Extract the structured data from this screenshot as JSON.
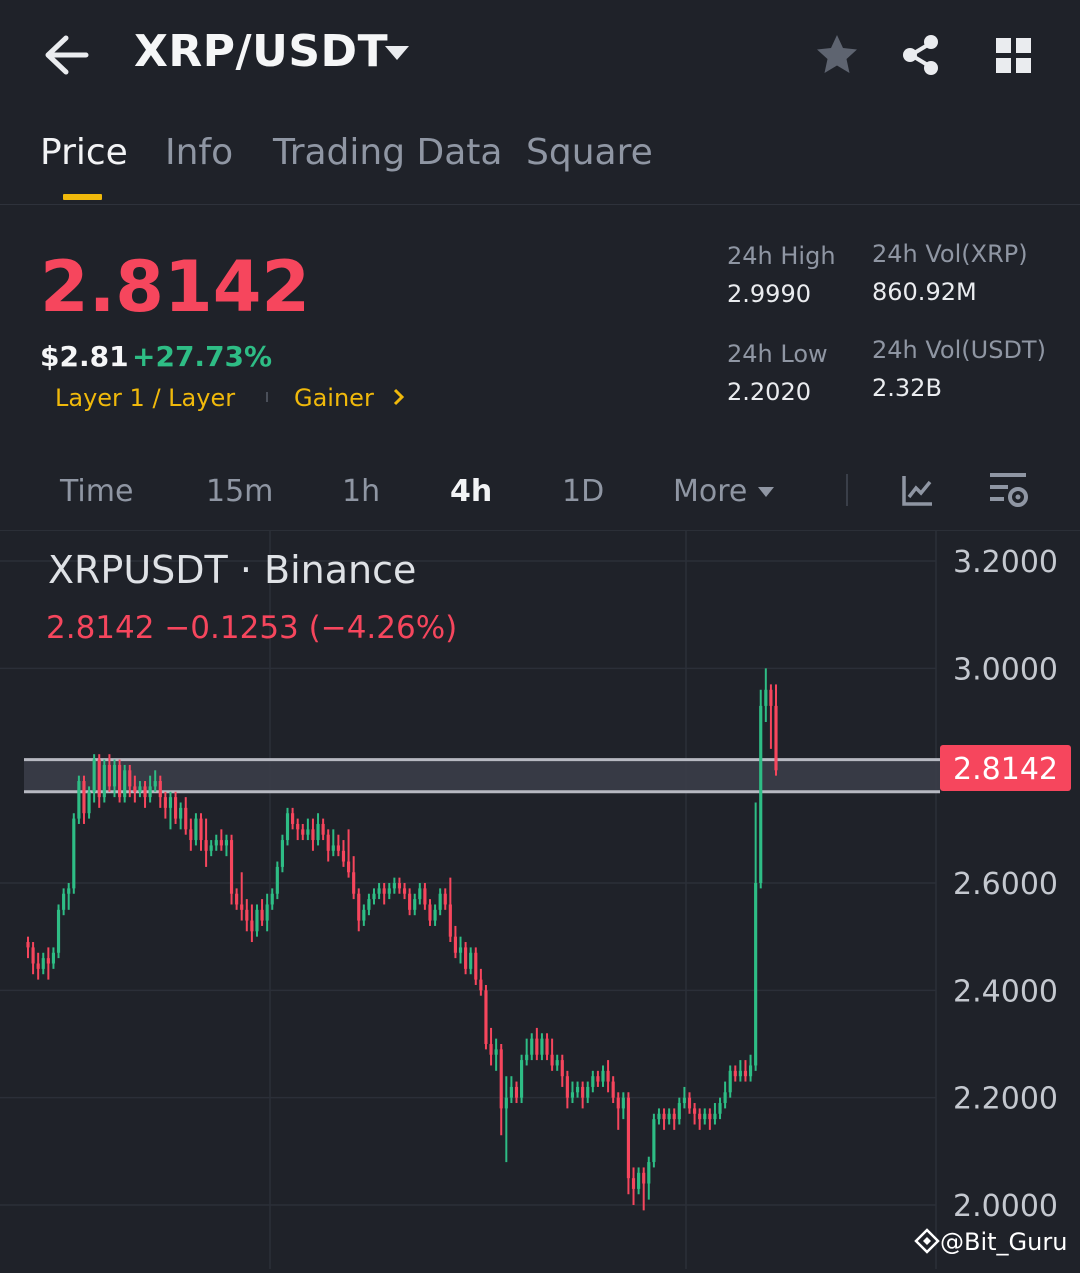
{
  "header": {
    "back_icon": "arrow-left-icon",
    "pair": "XRP/USDT",
    "dropdown_icon": "caret-down-icon",
    "favorite_icon": "star-icon",
    "share_icon": "share-icon",
    "grid_icon": "grid-icon"
  },
  "tabs": [
    {
      "label": "Price",
      "active": true
    },
    {
      "label": "Info",
      "active": false
    },
    {
      "label": "Trading Data",
      "active": false
    },
    {
      "label": "Square",
      "active": false
    }
  ],
  "ticker": {
    "last_price": "2.8142",
    "usd_price": "$2.81",
    "change_pct": "+27.73%",
    "tag_category": "Layer 1 / Layer",
    "tag_gainer": "Gainer",
    "stats": {
      "high_label": "24h High",
      "high_value": "2.9990",
      "low_label": "24h Low",
      "low_value": "2.2020",
      "vol_base_label": "24h Vol(XRP)",
      "vol_base_value": "860.92M",
      "vol_quote_label": "24h Vol(USDT)",
      "vol_quote_value": "2.32B"
    }
  },
  "intervals": {
    "items": [
      "Time",
      "15m",
      "1h",
      "4h",
      "1D",
      "More"
    ],
    "active": "4h"
  },
  "chart_header": {
    "title": "XRPUSDT · Binance",
    "ohlc": "2.8142  −0.1253 (−4.26%)"
  },
  "watermark": "@Bit_Guru",
  "colors": {
    "background": "#1f2229",
    "up": "#2ebd85",
    "down": "#f6465d",
    "accent": "#f0b90b"
  },
  "chart_data": {
    "type": "candlestick",
    "symbol": "XRPUSDT",
    "exchange": "Binance",
    "interval": "4h",
    "ylim": [
      1.96,
      3.24
    ],
    "y_ticks": [
      "3.2000",
      "3.0000",
      "2.6000",
      "2.4000",
      "2.2000",
      "2.0000"
    ],
    "last_price_label": "2.8142",
    "grid": true,
    "zone": [
      2.77,
      2.83
    ],
    "candles": [
      [
        2.49,
        2.48,
        2.5,
        2.46
      ],
      [
        2.48,
        2.45,
        2.49,
        2.43
      ],
      [
        2.45,
        2.44,
        2.47,
        2.42
      ],
      [
        2.44,
        2.46,
        2.47,
        2.43
      ],
      [
        2.46,
        2.45,
        2.48,
        2.42
      ],
      [
        2.45,
        2.47,
        2.48,
        2.44
      ],
      [
        2.47,
        2.55,
        2.56,
        2.46
      ],
      [
        2.55,
        2.58,
        2.59,
        2.54
      ],
      [
        2.58,
        2.59,
        2.6,
        2.55
      ],
      [
        2.59,
        2.72,
        2.73,
        2.58
      ],
      [
        2.72,
        2.79,
        2.8,
        2.71
      ],
      [
        2.79,
        2.73,
        2.8,
        2.71
      ],
      [
        2.73,
        2.77,
        2.78,
        2.72
      ],
      [
        2.77,
        2.83,
        2.84,
        2.75
      ],
      [
        2.83,
        2.76,
        2.84,
        2.74
      ],
      [
        2.76,
        2.82,
        2.83,
        2.75
      ],
      [
        2.82,
        2.78,
        2.84,
        2.77
      ],
      [
        2.78,
        2.82,
        2.83,
        2.76
      ],
      [
        2.82,
        2.76,
        2.83,
        2.75
      ],
      [
        2.76,
        2.81,
        2.82,
        2.75
      ],
      [
        2.81,
        2.78,
        2.82,
        2.76
      ],
      [
        2.78,
        2.77,
        2.8,
        2.75
      ],
      [
        2.77,
        2.78,
        2.79,
        2.76
      ],
      [
        2.78,
        2.76,
        2.79,
        2.74
      ],
      [
        2.76,
        2.78,
        2.8,
        2.75
      ],
      [
        2.78,
        2.79,
        2.81,
        2.77
      ],
      [
        2.79,
        2.76,
        2.8,
        2.74
      ],
      [
        2.76,
        2.74,
        2.77,
        2.72
      ],
      [
        2.74,
        2.76,
        2.77,
        2.7
      ],
      [
        2.76,
        2.72,
        2.77,
        2.71
      ],
      [
        2.72,
        2.74,
        2.75,
        2.7
      ],
      [
        2.74,
        2.7,
        2.76,
        2.69
      ],
      [
        2.7,
        2.68,
        2.72,
        2.66
      ],
      [
        2.68,
        2.72,
        2.73,
        2.67
      ],
      [
        2.72,
        2.68,
        2.73,
        2.66
      ],
      [
        2.68,
        2.66,
        2.72,
        2.63
      ],
      [
        2.66,
        2.67,
        2.68,
        2.65
      ],
      [
        2.67,
        2.68,
        2.69,
        2.66
      ],
      [
        2.68,
        2.67,
        2.7,
        2.66
      ],
      [
        2.67,
        2.68,
        2.69,
        2.65
      ],
      [
        2.68,
        2.58,
        2.69,
        2.56
      ],
      [
        2.58,
        2.56,
        2.59,
        2.55
      ],
      [
        2.56,
        2.55,
        2.62,
        2.53
      ],
      [
        2.55,
        2.53,
        2.57,
        2.51
      ],
      [
        2.53,
        2.51,
        2.56,
        2.49
      ],
      [
        2.51,
        2.55,
        2.56,
        2.5
      ],
      [
        2.55,
        2.53,
        2.57,
        2.52
      ],
      [
        2.53,
        2.56,
        2.58,
        2.51
      ],
      [
        2.56,
        2.58,
        2.59,
        2.55
      ],
      [
        2.58,
        2.63,
        2.64,
        2.57
      ],
      [
        2.63,
        2.68,
        2.69,
        2.62
      ],
      [
        2.68,
        2.73,
        2.74,
        2.67
      ],
      [
        2.73,
        2.71,
        2.74,
        2.7
      ],
      [
        2.71,
        2.7,
        2.72,
        2.68
      ],
      [
        2.7,
        2.69,
        2.71,
        2.68
      ],
      [
        2.69,
        2.7,
        2.72,
        2.68
      ],
      [
        2.7,
        2.68,
        2.72,
        2.66
      ],
      [
        2.68,
        2.71,
        2.73,
        2.67
      ],
      [
        2.71,
        2.69,
        2.72,
        2.68
      ],
      [
        2.69,
        2.66,
        2.7,
        2.64
      ],
      [
        2.66,
        2.67,
        2.7,
        2.65
      ],
      [
        2.67,
        2.66,
        2.69,
        2.65
      ],
      [
        2.66,
        2.64,
        2.68,
        2.63
      ],
      [
        2.64,
        2.62,
        2.7,
        2.61
      ],
      [
        2.62,
        2.58,
        2.65,
        2.57
      ],
      [
        2.58,
        2.53,
        2.59,
        2.51
      ],
      [
        2.53,
        2.55,
        2.56,
        2.52
      ],
      [
        2.55,
        2.57,
        2.58,
        2.54
      ],
      [
        2.57,
        2.58,
        2.59,
        2.56
      ],
      [
        2.58,
        2.59,
        2.6,
        2.57
      ],
      [
        2.59,
        2.58,
        2.6,
        2.56
      ],
      [
        2.58,
        2.59,
        2.6,
        2.57
      ],
      [
        2.59,
        2.6,
        2.61,
        2.58
      ],
      [
        2.6,
        2.59,
        2.61,
        2.58
      ],
      [
        2.59,
        2.58,
        2.6,
        2.57
      ],
      [
        2.58,
        2.55,
        2.59,
        2.54
      ],
      [
        2.55,
        2.57,
        2.58,
        2.54
      ],
      [
        2.57,
        2.59,
        2.6,
        2.56
      ],
      [
        2.59,
        2.56,
        2.6,
        2.55
      ],
      [
        2.56,
        2.53,
        2.57,
        2.52
      ],
      [
        2.53,
        2.55,
        2.56,
        2.52
      ],
      [
        2.55,
        2.58,
        2.59,
        2.54
      ],
      [
        2.58,
        2.56,
        2.59,
        2.55
      ],
      [
        2.56,
        2.5,
        2.61,
        2.49
      ],
      [
        2.5,
        2.47,
        2.52,
        2.46
      ],
      [
        2.47,
        2.48,
        2.5,
        2.45
      ],
      [
        2.48,
        2.44,
        2.49,
        2.43
      ],
      [
        2.44,
        2.47,
        2.48,
        2.43
      ],
      [
        2.47,
        2.42,
        2.48,
        2.41
      ],
      [
        2.42,
        2.4,
        2.44,
        2.39
      ],
      [
        2.4,
        2.3,
        2.41,
        2.29
      ],
      [
        2.3,
        2.28,
        2.33,
        2.26
      ],
      [
        2.28,
        2.29,
        2.31,
        2.25
      ],
      [
        2.29,
        2.18,
        2.3,
        2.13
      ],
      [
        2.18,
        2.2,
        2.24,
        2.08
      ],
      [
        2.2,
        2.22,
        2.24,
        2.19
      ],
      [
        2.22,
        2.2,
        2.23,
        2.19
      ],
      [
        2.2,
        2.27,
        2.28,
        2.19
      ],
      [
        2.27,
        2.28,
        2.31,
        2.26
      ],
      [
        2.28,
        2.31,
        2.32,
        2.27
      ],
      [
        2.31,
        2.28,
        2.33,
        2.27
      ],
      [
        2.28,
        2.31,
        2.32,
        2.27
      ],
      [
        2.31,
        2.28,
        2.32,
        2.27
      ],
      [
        2.28,
        2.26,
        2.31,
        2.25
      ],
      [
        2.26,
        2.27,
        2.28,
        2.25
      ],
      [
        2.27,
        2.24,
        2.28,
        2.22
      ],
      [
        2.24,
        2.2,
        2.25,
        2.18
      ],
      [
        2.2,
        2.21,
        2.23,
        2.19
      ],
      [
        2.21,
        2.22,
        2.23,
        2.2
      ],
      [
        2.22,
        2.2,
        2.23,
        2.18
      ],
      [
        2.2,
        2.22,
        2.23,
        2.19
      ],
      [
        2.22,
        2.24,
        2.25,
        2.21
      ],
      [
        2.24,
        2.23,
        2.25,
        2.22
      ],
      [
        2.23,
        2.25,
        2.26,
        2.22
      ],
      [
        2.25,
        2.23,
        2.27,
        2.21
      ],
      [
        2.23,
        2.2,
        2.24,
        2.19
      ],
      [
        2.2,
        2.18,
        2.21,
        2.14
      ],
      [
        2.18,
        2.2,
        2.21,
        2.16
      ],
      [
        2.2,
        2.05,
        2.21,
        2.02
      ],
      [
        2.05,
        2.03,
        2.07,
        2.0
      ],
      [
        2.03,
        2.06,
        2.07,
        2.02
      ],
      [
        2.06,
        2.04,
        2.07,
        1.99
      ],
      [
        2.04,
        2.08,
        2.09,
        2.01
      ],
      [
        2.08,
        2.16,
        2.17,
        2.07
      ],
      [
        2.16,
        2.17,
        2.18,
        2.15
      ],
      [
        2.17,
        2.16,
        2.18,
        2.14
      ],
      [
        2.16,
        2.17,
        2.18,
        2.15
      ],
      [
        2.17,
        2.16,
        2.18,
        2.14
      ],
      [
        2.16,
        2.19,
        2.2,
        2.15
      ],
      [
        2.19,
        2.2,
        2.22,
        2.18
      ],
      [
        2.2,
        2.18,
        2.21,
        2.17
      ],
      [
        2.18,
        2.17,
        2.19,
        2.15
      ],
      [
        2.17,
        2.16,
        2.18,
        2.14
      ],
      [
        2.16,
        2.17,
        2.18,
        2.15
      ],
      [
        2.17,
        2.16,
        2.18,
        2.14
      ],
      [
        2.16,
        2.17,
        2.19,
        2.15
      ],
      [
        2.17,
        2.19,
        2.2,
        2.16
      ],
      [
        2.19,
        2.21,
        2.23,
        2.18
      ],
      [
        2.21,
        2.25,
        2.26,
        2.2
      ],
      [
        2.25,
        2.24,
        2.26,
        2.23
      ],
      [
        2.24,
        2.25,
        2.27,
        2.23
      ],
      [
        2.25,
        2.24,
        2.27,
        2.23
      ],
      [
        2.24,
        2.26,
        2.28,
        2.23
      ],
      [
        2.26,
        2.6,
        2.75,
        2.25
      ],
      [
        2.6,
        2.93,
        2.96,
        2.59
      ],
      [
        2.93,
        2.96,
        3.0,
        2.9
      ],
      [
        2.96,
        2.93,
        2.97,
        2.85
      ],
      [
        2.93,
        2.81,
        2.97,
        2.8
      ]
    ]
  }
}
